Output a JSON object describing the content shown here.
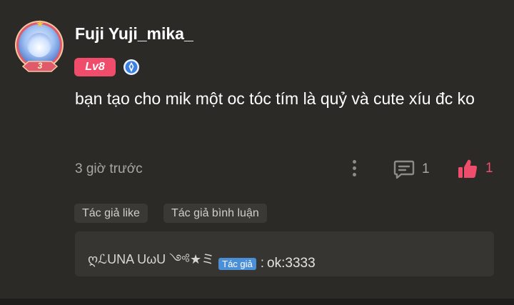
{
  "comment": {
    "username": "Fuji Yuji_mika_",
    "level": "Lv8",
    "avatar_badge": "3",
    "text": "bạn tạo cho mik một oc tóc tím là quỷ và cute xíu đc ko",
    "time": "3 giờ trước",
    "reply_count": "1",
    "like_count": "1"
  },
  "tags": {
    "author_liked": "Tác giả like",
    "author_commented": "Tác giả bình luận"
  },
  "reply": {
    "author": "ღℒUNA UωU ༺★ミ",
    "author_badge": "Tác giả",
    "separator": ":",
    "text": "ok:3333"
  },
  "colors": {
    "background": "#2b2a27",
    "level_badge": "#ef4d6b",
    "like": "#ef4d6b",
    "author_badge": "#4a8fd8"
  },
  "icons": [
    "verified-icon",
    "more-icon",
    "comment-icon",
    "thumbs-up-icon"
  ]
}
